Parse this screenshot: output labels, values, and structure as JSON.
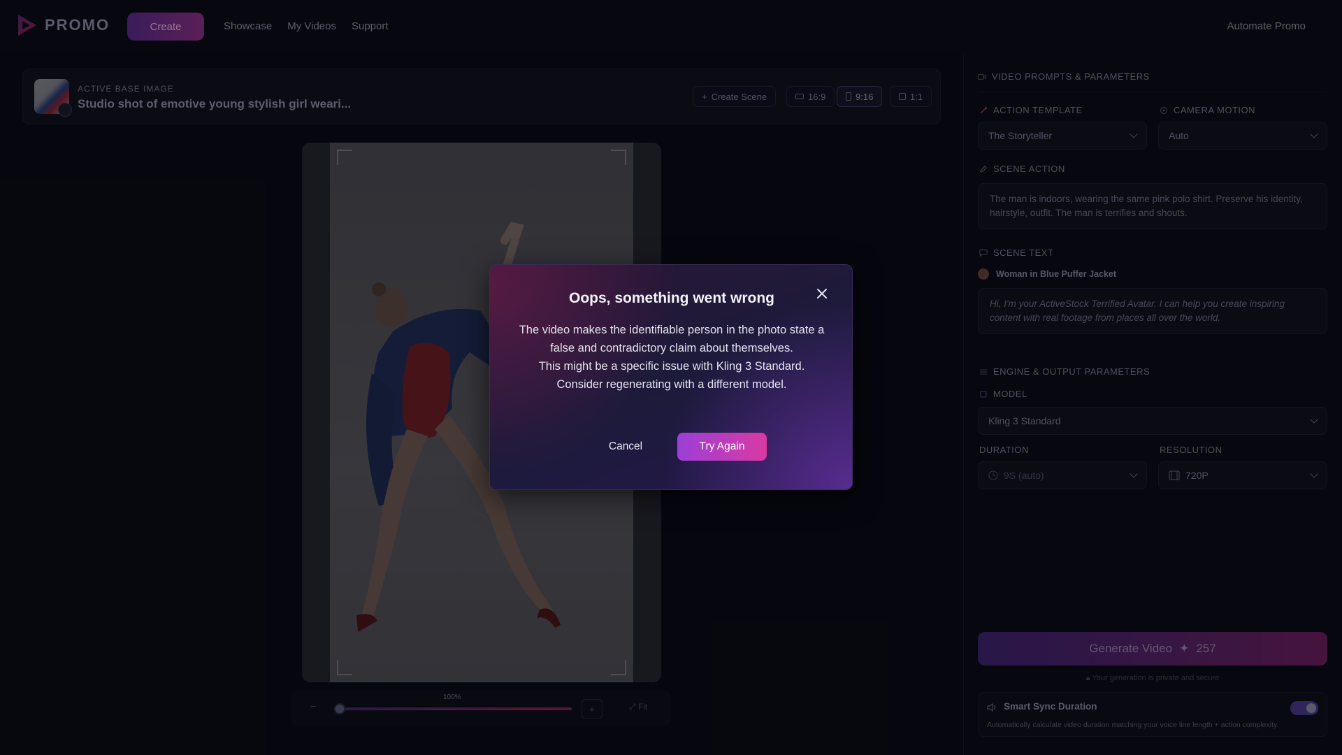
{
  "nav": {
    "logo_text": "PROMO",
    "create_label": "Create",
    "links": [
      "Showcase",
      "My Videos",
      "Support"
    ],
    "right_link": "Automate Promo"
  },
  "image_bar": {
    "label": "ACTIVE BASE IMAGE",
    "title": "Studio shot of emotive young stylish girl weari...",
    "create_scene": "Create Scene",
    "ratios": [
      "16:9",
      "9:16",
      "1:1"
    ],
    "active_ratio": "9:16"
  },
  "zoom": {
    "percent": "100%",
    "fit_label": "Fit",
    "minus": "−",
    "plus": "+"
  },
  "panel": {
    "header": "VIDEO PROMPTS & PARAMETERS",
    "action_template": {
      "label": "ACTION TEMPLATE",
      "value": "The Storyteller"
    },
    "camera_motion": {
      "label": "CAMERA MOTION",
      "value": "Auto"
    },
    "scene_action": {
      "label": "SCENE ACTION",
      "text": "The man is indoors, wearing the same pink polo shirt. Preserve his identity, hairstyle, outfit. The man is terrifies and shouts."
    },
    "scene_text": {
      "label": "SCENE TEXT",
      "avatar_name": "Woman in Blue Puffer Jacket",
      "text": "Hi, I'm your ActiveStock Terrified Avatar. I can help you create inspiring content with real footage from places all over the world."
    },
    "engine_header": "ENGINE & OUTPUT PARAMETERS",
    "model": {
      "label": "MODEL",
      "value": "Kling 3 Standard"
    },
    "duration": {
      "label": "DURATION",
      "value": "9S (auto)"
    },
    "resolution": {
      "label": "RESOLUTION",
      "value": "720P"
    },
    "generate": {
      "label": "Generate Video",
      "credits": "257"
    },
    "private_note": "Your generation is private and secure",
    "smart_sync": {
      "title": "Smart Sync Duration",
      "desc": "Automatically calculate video duration matching your voice line length + action complexity.",
      "enabled": true
    }
  },
  "modal": {
    "title": "Oops, something went wrong",
    "lines": [
      "The video makes the identifiable person in the photo state a",
      "false and contradictory claim about themselves.",
      "This might be a specific issue with Kling 3 Standard.",
      "Consider regenerating with a different model."
    ],
    "cancel_label": "Cancel",
    "retry_label": "Try Again"
  },
  "colors": {
    "accent_start": "#9b3fd6",
    "accent_end": "#d93aa2",
    "background": "#0c0c1a"
  }
}
